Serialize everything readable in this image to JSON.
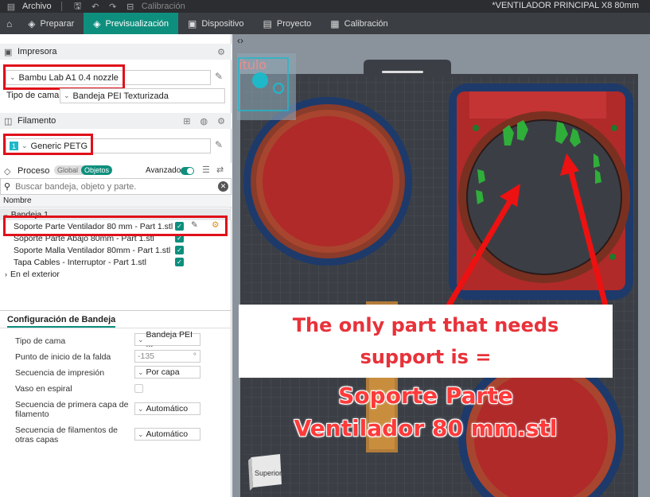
{
  "titlebar": {
    "file_menu": "Archivo",
    "calibration": "Calibración",
    "document_title": "*VENTILADOR PRINCIPAL X8 80mm"
  },
  "tabs": [
    {
      "label": "Preparar"
    },
    {
      "label": "Previsualización",
      "active": true
    },
    {
      "label": "Dispositivo"
    },
    {
      "label": "Proyecto"
    },
    {
      "label": "Calibración"
    }
  ],
  "printer": {
    "section_title": "Impresora",
    "selected": "Bambu Lab A1 0.4 nozzle",
    "bed_type_label": "Tipo de cama",
    "bed_type": "Bandeja PEI Texturizada"
  },
  "filament": {
    "section_title": "Filamento",
    "slot": "1",
    "selected": "Generic PETG"
  },
  "process": {
    "section_title": "Proceso",
    "toggle_global": "Global",
    "toggle_objects": "Objetos",
    "advanced_label": "Avanzado",
    "search_placeholder": "Buscar bandeja, objeto y parte.",
    "column_name": "Nombre",
    "plate": "Bandeja 1",
    "objects": [
      "Soporte Parte Ventilador 80 mm - Part 1.stl",
      "Soporte Parte Abajo 80mm - Part 1.stl",
      "Soporte Malla Ventilador 80mm - Part 1.stl",
      "Tapa Cables - Interruptor - Part 1.stl"
    ],
    "outside": "En el exterior"
  },
  "plate_config": {
    "title": "Configuración de Bandeja",
    "rows": [
      {
        "label": "Tipo de cama",
        "value": "Bandeja PEI ..."
      },
      {
        "label": "Punto de inicio de la falda",
        "value": "-135",
        "unit": "°"
      },
      {
        "label": "Secuencia de impresión",
        "value": "Por capa"
      },
      {
        "label": "Vaso en espiral",
        "value": ""
      },
      {
        "label": "Secuencia de primera capa de filamento",
        "value": "Automático"
      },
      {
        "label": "Secuencia de filamentos de otras capas",
        "value": "Automático"
      }
    ]
  },
  "viewport": {
    "thumbnail_title": "ítulo",
    "view_cube_label": "Superior",
    "annotation_line1": "The only part that needs",
    "annotation_line2": "support is =",
    "annotation_part1": "Soporte Parte",
    "annotation_part2": "Ventilador 80 mm.stl"
  },
  "colors": {
    "accent": "#0e8f7e",
    "annotation_red": "#e0101a",
    "print_body": "#b02a2a",
    "brim": "#1d3a6b",
    "support": "#2fae3a"
  }
}
